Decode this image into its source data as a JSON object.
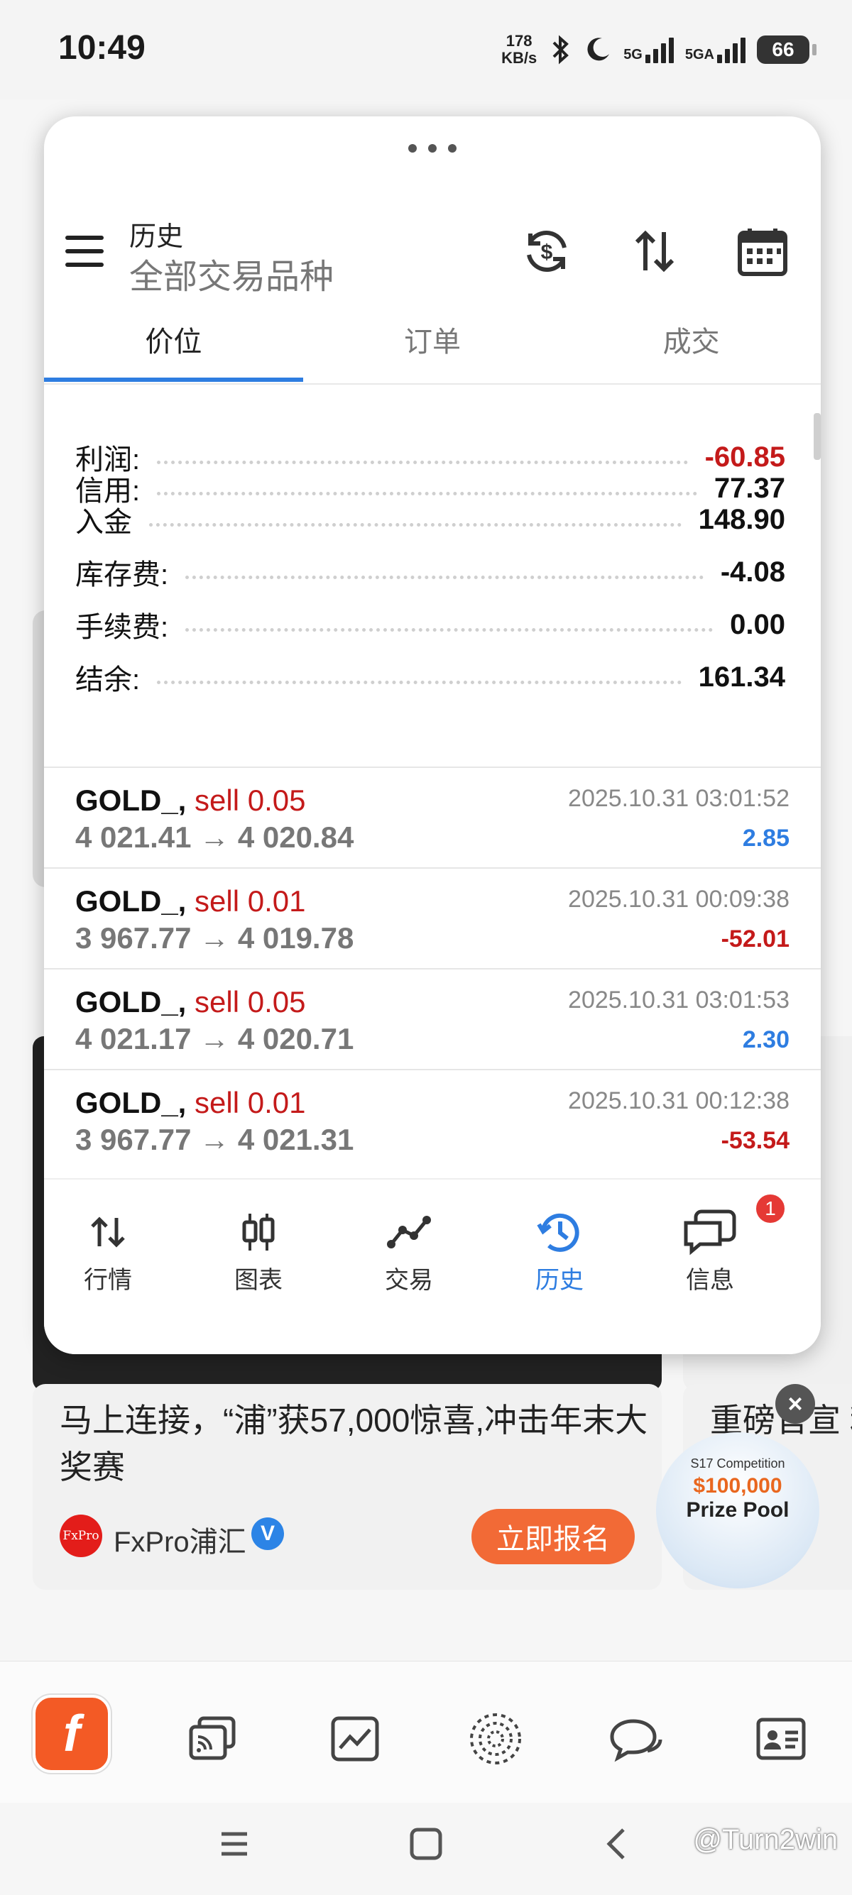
{
  "status": {
    "time": "10:49",
    "net_speed_value": "178",
    "net_speed_unit": "KB/s",
    "sig1": "5G",
    "sig2": "5GA",
    "battery": "66"
  },
  "history": {
    "title": "历史",
    "subtitle": "全部交易品种",
    "tabs": [
      "价位",
      "订单",
      "成交"
    ],
    "summary": [
      {
        "label": "利润:",
        "value": "-60.85"
      },
      {
        "label": "信用:",
        "value": "77.37"
      },
      {
        "label": "入金",
        "value": "148.90"
      },
      {
        "label": "库存费:",
        "value": "-4.08"
      },
      {
        "label": "手续费:",
        "value": "0.00"
      },
      {
        "label": "结余:",
        "value": "161.34"
      }
    ],
    "trades": [
      {
        "symbol": "GOLD_,",
        "type": "sell 0.05",
        "price": "4 021.41 → 4 020.84",
        "time": "2025.10.31 03:01:52",
        "profit": "2.85"
      },
      {
        "symbol": "GOLD_,",
        "type": "sell 0.01",
        "price": "3 967.77 → 4 019.78",
        "time": "2025.10.31 00:09:38",
        "profit": "-52.01"
      },
      {
        "symbol": "GOLD_,",
        "type": "sell 0.05",
        "price": "4 021.17 → 4 020.71",
        "time": "2025.10.31 03:01:53",
        "profit": "2.30"
      },
      {
        "symbol": "GOLD_,",
        "type": "sell 0.01",
        "price": "3 967.77 → 4 021.31",
        "time": "2025.10.31 00:12:38",
        "profit": "-53.54"
      }
    ],
    "nav": [
      {
        "label": "行情",
        "icon": "arrows-updown-icon"
      },
      {
        "label": "图表",
        "icon": "candlestick-icon"
      },
      {
        "label": "交易",
        "icon": "trend-line-icon"
      },
      {
        "label": "历史",
        "icon": "history-clock-icon"
      },
      {
        "label": "信息",
        "icon": "chat-bubbles-icon"
      }
    ],
    "badge": "1",
    "colors": {
      "accent": "#2e7de1",
      "negative": "#c41a1a",
      "positive": "#2e7de1"
    }
  },
  "feed": {
    "article_title": "马上连接，“浦”获57,000惊喜,冲击年末大奖赛",
    "right_title": "重磅官宣 利",
    "author": "FxPro浦汇",
    "fx_logo": "FxPro",
    "signup": "立即报名",
    "promo_line1": "S17 Competition",
    "promo_line2": "$100,000",
    "promo_line3": "Prize Pool"
  },
  "watermark": "@Turn2win"
}
